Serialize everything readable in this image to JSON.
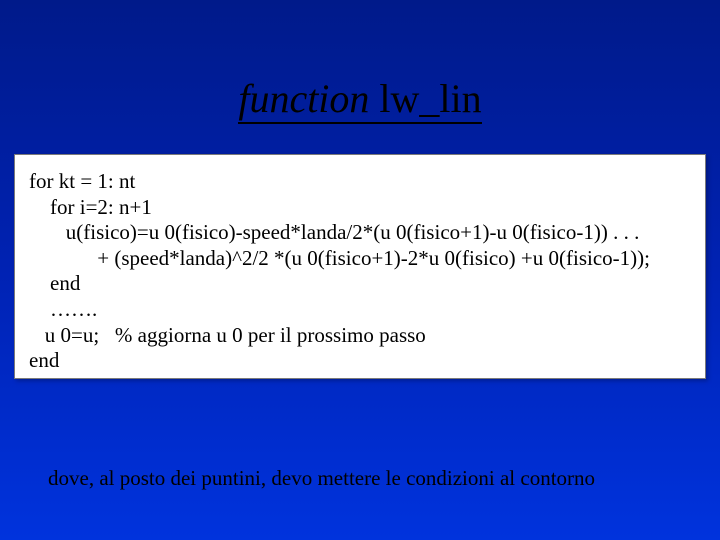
{
  "title": {
    "word_function": "function",
    "name": " lw_lin"
  },
  "code": {
    "l1": "for kt = 1: nt",
    "l2": "    for i=2: n+1",
    "l3": "       u(fisico)=u 0(fisico)-speed*landa/2*(u 0(fisico+1)-u 0(fisico-1)) . . .",
    "l4": "             + (speed*landa)^2/2 *(u 0(fisico+1)-2*u 0(fisico) +u 0(fisico-1));",
    "l5": "    end",
    "l6": "    …….",
    "l7": "   u 0=u;   % aggiorna u 0 per il prossimo passo",
    "l8": "end"
  },
  "footer": "dove, al posto dei puntini, devo mettere le condizioni al contorno"
}
